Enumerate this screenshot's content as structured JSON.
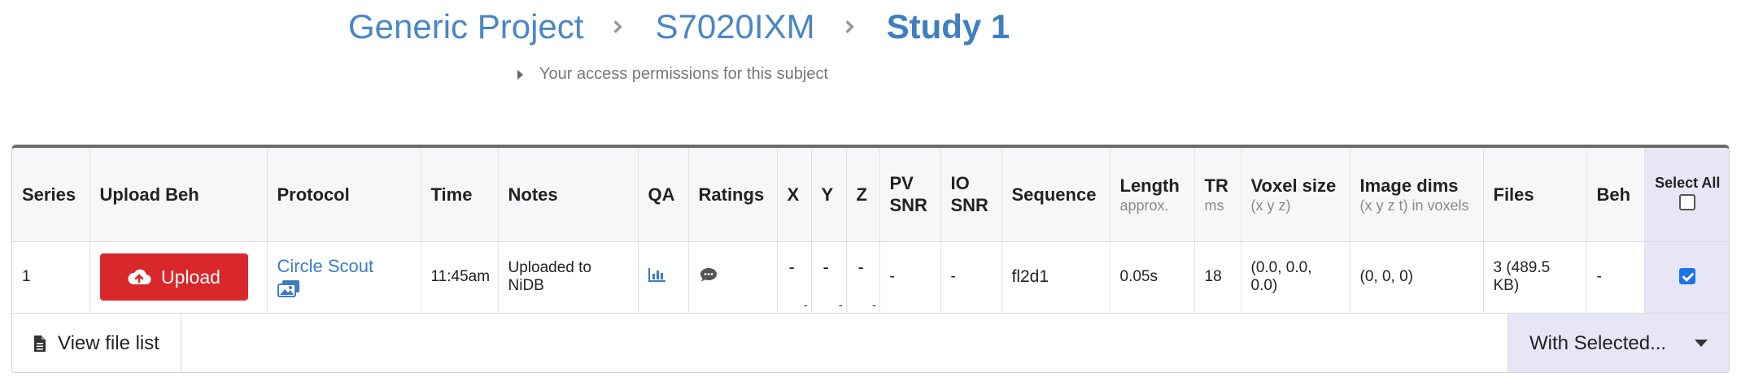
{
  "breadcrumb": {
    "project": "Generic Project",
    "subject": "S7020IXM",
    "study": "Study 1"
  },
  "access_text": "Your access permissions for this subject",
  "table": {
    "headers": {
      "series": "Series",
      "upload_beh": "Upload Beh",
      "protocol": "Protocol",
      "time": "Time",
      "notes": "Notes",
      "qa": "QA",
      "ratings": "Ratings",
      "x": "X",
      "y": "Y",
      "z": "Z",
      "pv_snr": "PV SNR",
      "io_snr": "IO SNR",
      "sequence": "Sequence",
      "length": "Length",
      "length_sub": "approx.",
      "tr": "TR",
      "tr_sub": "ms",
      "voxel": "Voxel size",
      "voxel_sub": "(x y z)",
      "image_dims": "Image dims",
      "image_dims_sub": "(x y z t) in voxels",
      "files": "Files",
      "beh": "Beh",
      "select_all": "Select All"
    },
    "row": {
      "series": "1",
      "upload_label": "Upload",
      "protocol": "Circle Scout",
      "time": "11:45am",
      "notes": "Uploaded to NiDB",
      "x": "-",
      "x_sub": "-",
      "y": "-",
      "y_sub": "-",
      "z": "-",
      "z_sub": "-",
      "pv_snr": "-",
      "io_snr": "-",
      "sequence": "fl2d1",
      "length": "0.05s",
      "tr": "18",
      "voxel": "(0.0, 0.0, 0.0)",
      "image_dims": "(0, 0, 0)",
      "files": "3 (489.5 KB)",
      "beh": "-",
      "selected": true
    }
  },
  "footer": {
    "view_files": "View file list",
    "with_selected": "With Selected..."
  },
  "colors": {
    "link": "#4a86c8",
    "upload_button": "#d9282b",
    "select_column": "#e6e6f7",
    "checkbox_checked": "#1a73e8"
  },
  "icons": {
    "upload": "cloud-upload-icon",
    "protocol": "images-icon",
    "qa": "bar-chart-icon",
    "ratings": "comment-icon",
    "view_files": "file-icon"
  }
}
